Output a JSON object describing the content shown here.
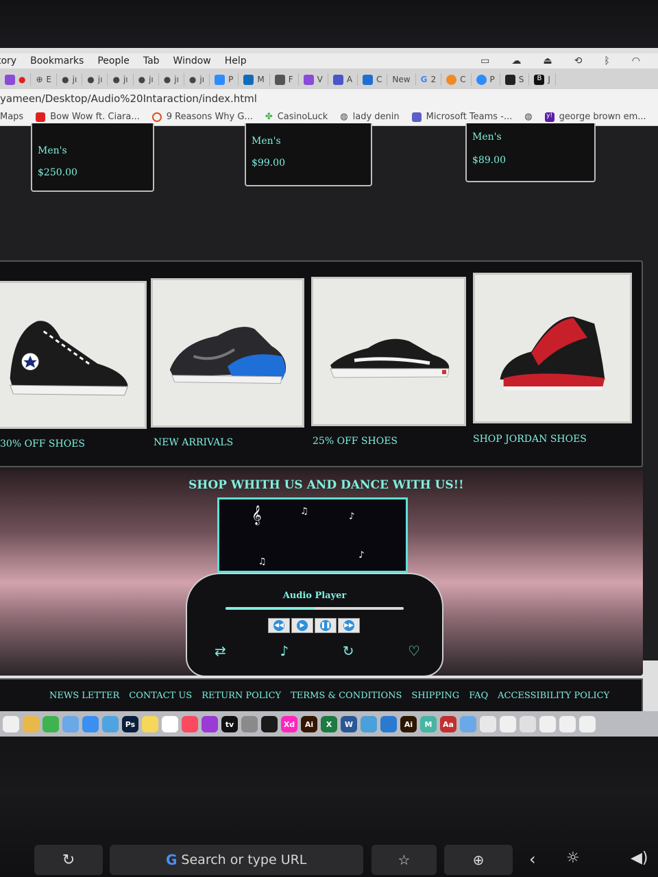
{
  "menubar": {
    "items": [
      "tory",
      "Bookmarks",
      "People",
      "Tab",
      "Window",
      "Help"
    ]
  },
  "tabs": [
    {
      "label": "E",
      "color": "#6b6b6b"
    },
    {
      "label": "jı",
      "color": "#222222"
    },
    {
      "label": "jı",
      "color": "#222222"
    },
    {
      "label": "jı",
      "color": "#222222"
    },
    {
      "label": "jı",
      "color": "#222222"
    },
    {
      "label": "jı",
      "color": "#222222"
    },
    {
      "label": "jı",
      "color": "#222222"
    },
    {
      "label": "P",
      "color": "#2d8cff"
    },
    {
      "label": "M",
      "color": "#0f6cbd"
    },
    {
      "label": "F",
      "color": "#555555"
    },
    {
      "label": "V",
      "color": "#8a4bd6"
    },
    {
      "label": "A",
      "color": "#4a55c8"
    },
    {
      "label": "C",
      "color": "#1f6fd0"
    },
    {
      "label": "New",
      "color": ""
    },
    {
      "label": "2",
      "color": "#4285f4"
    },
    {
      "label": "C",
      "color": "#f08a24"
    },
    {
      "label": "P",
      "color": "#2d8cff"
    },
    {
      "label": "S",
      "color": "#222222"
    },
    {
      "label": "J",
      "color": "#111111"
    }
  ],
  "address": {
    "url": "yameen/Desktop/Audio%20Intaraction/index.html"
  },
  "bookmarks": [
    {
      "label": "Maps",
      "color": ""
    },
    {
      "label": "Bow Wow ft. Ciara...",
      "color": "#e02020"
    },
    {
      "label": "9 Reasons Why G...",
      "color": "#e0501a"
    },
    {
      "label": "CasinoLuck",
      "color": "#3fb34f"
    },
    {
      "label": "lady denin",
      "color": "#555555"
    },
    {
      "label": "Microsoft Teams -...",
      "color": "#5b5fc7"
    },
    {
      "label": "",
      "color": "#555555"
    },
    {
      "label": "george brown em...",
      "color": "#5a1fa8"
    }
  ],
  "price_cards": [
    {
      "title": "Men's",
      "price": "$250.00"
    },
    {
      "title": "Men's",
      "price": "$99.00"
    },
    {
      "title": "Men's",
      "price": "$89.00"
    }
  ],
  "shoes": [
    {
      "label": "30% OFF SHOES",
      "icon": "converse-sneaker-icon"
    },
    {
      "label": "NEW ARRIVALS",
      "icon": "nike-air-max-icon"
    },
    {
      "label": "25% OFF SHOES",
      "icon": "vans-sneaker-icon"
    },
    {
      "label": "SHOP JORDAN SHOES",
      "icon": "jordan-sneaker-icon"
    }
  ],
  "dance": {
    "title": "SHOP WHITH US AND DANCE WITH US!!"
  },
  "player": {
    "title": "Audio Player",
    "progress": 0.5,
    "controls": [
      "rewind",
      "play",
      "pause",
      "fast-forward"
    ],
    "icons": [
      "repeat-icon",
      "music-note-icon",
      "refresh-icon",
      "heart-icon"
    ]
  },
  "footer": {
    "links": [
      "NEWS LETTER",
      "CONTACT US",
      "RETURN POLICY",
      "TERMS & CONDITIONS",
      "SHIPPING",
      "FAQ",
      "ACCESSIBILITY POLICY"
    ]
  },
  "dock": {
    "apps": [
      {
        "label": "",
        "color": "#f0f0f0"
      },
      {
        "label": "",
        "color": "#e8b84a"
      },
      {
        "label": "",
        "color": "#3fb34f"
      },
      {
        "label": "",
        "color": "#6aa8e8"
      },
      {
        "label": "",
        "color": "#3a8ff0"
      },
      {
        "label": "",
        "color": "#4fa3e0"
      },
      {
        "label": "Ps",
        "color": "#0a1f3a"
      },
      {
        "label": "",
        "color": "#f5d75a"
      },
      {
        "label": "",
        "color": "#ffffff"
      },
      {
        "label": "",
        "color": "#fa4a62"
      },
      {
        "label": "",
        "color": "#9c3ad6"
      },
      {
        "label": "tv",
        "color": "#111111"
      },
      {
        "label": "",
        "color": "#8a8a8a"
      },
      {
        "label": "",
        "color": "#1a1a1a"
      },
      {
        "label": "Xd",
        "color": "#ff26be"
      },
      {
        "label": "Ai",
        "color": "#331500"
      },
      {
        "label": "X",
        "color": "#1d7a43"
      },
      {
        "label": "W",
        "color": "#2b5797"
      },
      {
        "label": "",
        "color": "#4aa0d8"
      },
      {
        "label": "",
        "color": "#2a7ad0"
      },
      {
        "label": "Ai",
        "color": "#2b1700"
      },
      {
        "label": "M",
        "color": "#46b5a4"
      },
      {
        "label": "Aa",
        "color": "#c03030"
      },
      {
        "label": "",
        "color": "#6aa8e8"
      },
      {
        "label": "",
        "color": "#e8e8e8"
      },
      {
        "label": "",
        "color": "#f0f0f0"
      },
      {
        "label": "",
        "color": "#e0e0e0"
      },
      {
        "label": "",
        "color": "#f0f0f0"
      },
      {
        "label": "",
        "color": "#f0f0f0"
      },
      {
        "label": "",
        "color": "#f0f0f0"
      }
    ]
  },
  "touchbar": {
    "search": "Search or type URL"
  },
  "colors": {
    "accent": "#7ff0e0",
    "page_bg": "#1f1f22"
  }
}
